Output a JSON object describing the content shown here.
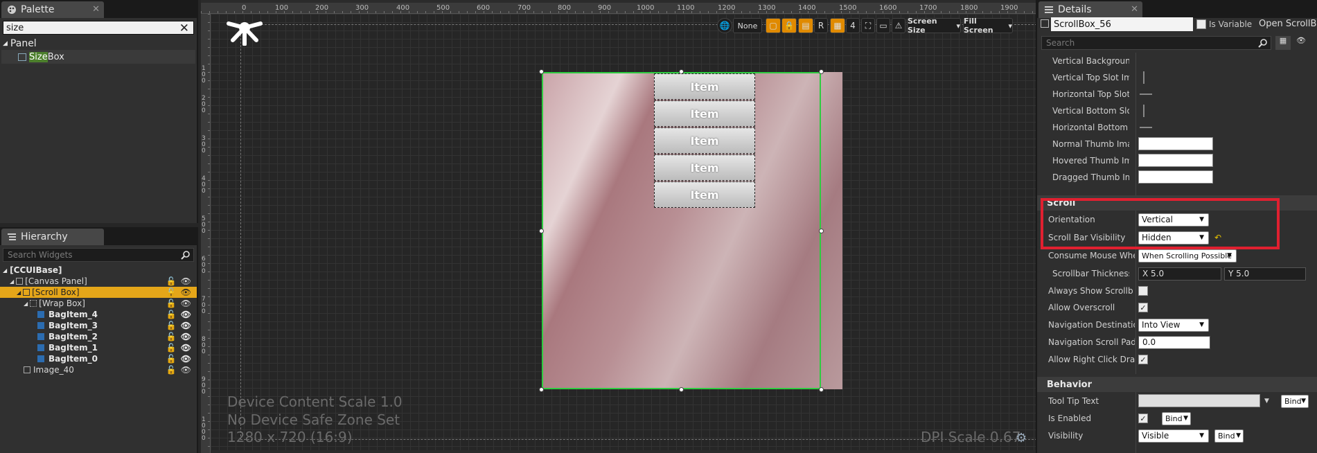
{
  "palette": {
    "tab_title": "Palette",
    "search_value": "size",
    "category": "Panel",
    "item_highlight": "Size",
    "item_rest": " Box"
  },
  "hierarchy": {
    "tab_title": "Hierarchy",
    "search_placeholder": "Search Widgets",
    "rows": [
      {
        "label": "[CCUIBase]",
        "indent": 0
      },
      {
        "label": "[Canvas Panel]",
        "indent": 1
      },
      {
        "label": "[Scroll Box]",
        "indent": 2
      },
      {
        "label": "[Wrap Box]",
        "indent": 3
      },
      {
        "label": "BagItem_4",
        "indent": 4
      },
      {
        "label": "BagItem_3",
        "indent": 4
      },
      {
        "label": "BagItem_2",
        "indent": 4
      },
      {
        "label": "BagItem_1",
        "indent": 4
      },
      {
        "label": "BagItem_0",
        "indent": 4
      },
      {
        "label": "Image_40",
        "indent": 2
      }
    ]
  },
  "designer": {
    "ruler_top": [
      "0",
      "100",
      "200",
      "300",
      "400",
      "500",
      "600",
      "700",
      "800",
      "900",
      "1000",
      "1100",
      "1200",
      "1300",
      "1400",
      "1500",
      "1600",
      "1700",
      "1800",
      "1900"
    ],
    "ruler_left": [
      "100",
      "200",
      "300",
      "400",
      "500",
      "600",
      "700",
      "800",
      "900",
      "1000"
    ],
    "toolbar": {
      "anchor_none": "None",
      "grid_value": "4",
      "r_label": "R",
      "screen_size": "Screen Size",
      "fill_screen": "Fill Screen"
    },
    "items": [
      "Item",
      "Item",
      "Item",
      "Item",
      "Item"
    ],
    "overlay": {
      "line1": "Device Content Scale 1.0",
      "line2": "No Device Safe Zone Set",
      "line3": "1280 x 720 (16:9)",
      "dpi": "DPI Scale 0.67"
    }
  },
  "details": {
    "tab_title": "Details",
    "widget_name": "ScrollBox_56",
    "is_variable": "Is Variable",
    "open_link": "Open ScrollBox",
    "search_placeholder": "Search",
    "style_rows": [
      "Vertical Background Im",
      "Vertical Top Slot Imag",
      "Horizontal Top Slot Im",
      "Vertical Bottom Slot Im",
      "Horizontal Bottom Slo",
      "Normal Thumb Image",
      "Hovered Thumb Image",
      "Dragged Thumb Image"
    ],
    "scroll_section": "Scroll",
    "orientation_label": "Orientation",
    "orientation_value": "Vertical",
    "visibility_label": "Scroll Bar Visibility",
    "visibility_value": "Hidden",
    "consume_label": "Consume Mouse Wheel",
    "consume_value": "When Scrolling Possible",
    "thickness_label": "Scrollbar Thickness",
    "thickness_x": "X  5.0",
    "thickness_y": "Y  5.0",
    "always_show_label": "Always Show Scrollb",
    "allow_overscroll_label": "Allow Overscroll",
    "nav_dest_label": "Navigation Destination",
    "nav_dest_value": "Into View",
    "nav_padding_label": "Navigation Scroll Paddin",
    "nav_padding_value": "0.0",
    "allow_right_label": "Allow Right Click Drag Sc",
    "behavior_section": "Behavior",
    "tooltip_label": "Tool Tip Text",
    "bind_label": "Bind",
    "enabled_label": "Is Enabled",
    "visibility2_label": "Visibility",
    "visibility2_value": "Visible"
  },
  "colors": {
    "selection": "#e5a619",
    "accent_green": "#2ecc40",
    "highlight_red": "#e02030"
  }
}
